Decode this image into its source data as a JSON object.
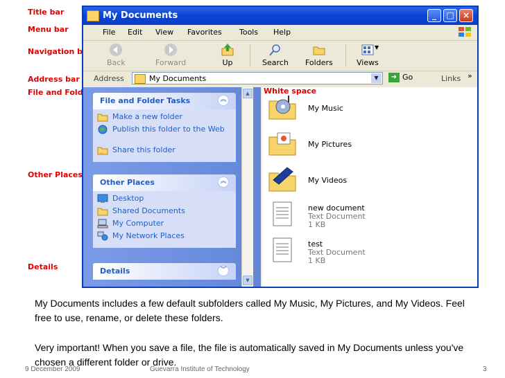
{
  "annotations": {
    "title_bar": "Title bar",
    "menu_bar": "Menu bar",
    "navigation_bar": "Navigation bar",
    "address_bar": "Address bar",
    "file_folder_tasks": "File and Folder Tasks list",
    "white_space": "White space",
    "other_places": "Other Places",
    "details": "Details"
  },
  "window": {
    "title": "My Documents",
    "min_label": "_",
    "max_label": "□",
    "close_label": "×"
  },
  "menu": [
    "File",
    "Edit",
    "View",
    "Favorites",
    "Tools",
    "Help"
  ],
  "toolbar": {
    "back": "Back",
    "forward": "Forward",
    "up": "Up",
    "search": "Search",
    "folders": "Folders",
    "views": "Views"
  },
  "address": {
    "label": "Address",
    "value": "My Documents",
    "go": "Go",
    "links": "Links",
    "chevron": "»"
  },
  "tasks": {
    "file_folder_title": "File and Folder Tasks",
    "file_folder_items": [
      "Make a new folder",
      "Publish this folder to the Web",
      "Share this folder"
    ],
    "other_places_title": "Other Places",
    "other_places_items": [
      "Desktop",
      "Shared Documents",
      "My Computer",
      "My Network Places"
    ],
    "details_title": "Details"
  },
  "files": [
    {
      "name": "My Music",
      "icon": "music-folder-icon"
    },
    {
      "name": "My Pictures",
      "icon": "pictures-folder-icon"
    },
    {
      "name": "My Videos",
      "icon": "videos-folder-icon"
    },
    {
      "name": "new document",
      "type": "Text Document",
      "size": "1 KB",
      "icon": "text-document-icon"
    },
    {
      "name": "test",
      "type": "Text Document",
      "size": "1 KB",
      "icon": "text-document-icon"
    }
  ],
  "caption": {
    "paragraph1": "My Documents includes a few default subfolders called My Music, My Pictures, and My Videos. Feel free to use, rename, or delete these folders.",
    "paragraph2": "Very important! When you save a file, the file is automatically saved in My Documents unless you've chosen a different folder or drive."
  },
  "footer": {
    "date": "9 December 2009",
    "institute": "Guevarra Institute of Technology",
    "page": "3"
  },
  "colors": {
    "annotation": "#e00000",
    "title_bar": "#0b46d6",
    "task_link": "#215dc6"
  }
}
